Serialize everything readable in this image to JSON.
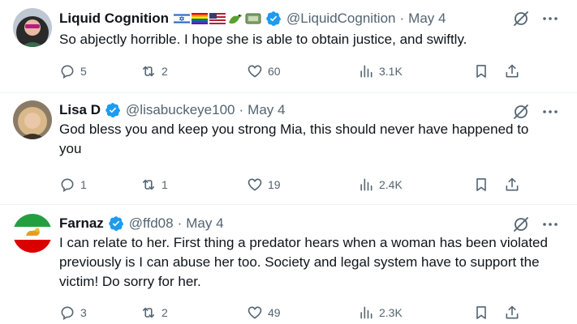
{
  "colors": {
    "verified": "#1d9bf0",
    "secondary_text": "#536471",
    "text": "#0f1419"
  },
  "tweets": [
    {
      "name": "Liquid Cognition",
      "emojis": [
        "israel-flag",
        "rainbow-flag",
        "us-flag",
        "dragon",
        "ticket"
      ],
      "handle": "@LiquidCognition",
      "date": "May 4",
      "text": "So abjectly horrible. I hope she is able to obtain justice, and swiftly.",
      "replies": "5",
      "reposts": "2",
      "likes": "60",
      "views": "3.1K"
    },
    {
      "name": "Lisa D",
      "handle": "@lisabuckeye100",
      "date": "May 4",
      "text": "God bless you and keep you strong Mia, this should never have happened to you",
      "replies": "1",
      "reposts": "1",
      "likes": "19",
      "views": "2.4K"
    },
    {
      "name": "Farnaz",
      "handle": "@ffd08",
      "date": "May 4",
      "text": "I can relate to her. First thing a predator hears when a woman has been violated previously is I can abuse her too. Society and legal system have to support the victim! Do sorry for her.",
      "replies": "3",
      "reposts": "2",
      "likes": "49",
      "views": "2.3K"
    }
  ],
  "separator": "·"
}
